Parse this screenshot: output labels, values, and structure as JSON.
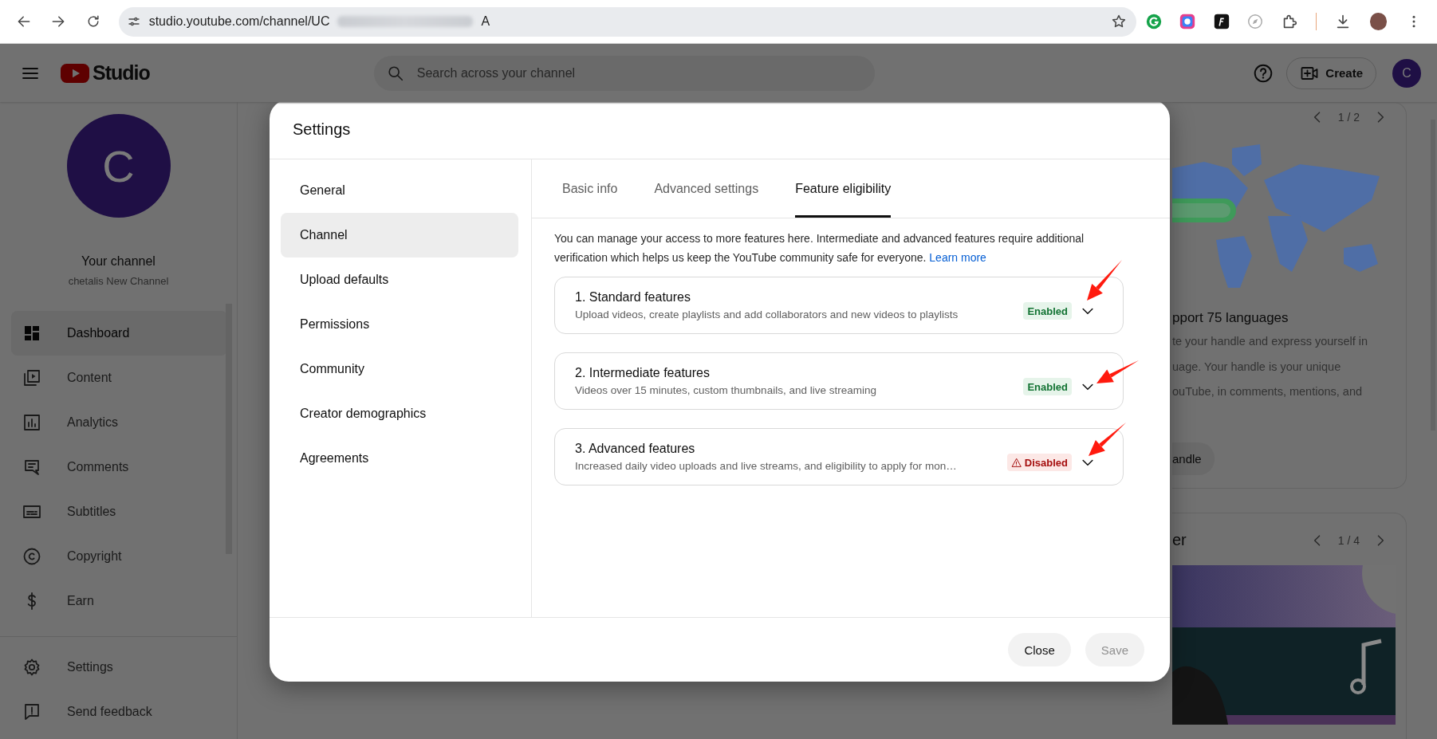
{
  "browser": {
    "url": "studio.youtube.com/channel/UC",
    "url_tail": "A"
  },
  "header": {
    "logo": "Studio",
    "search_placeholder": "Search across your channel",
    "create": "Create",
    "avatar": "C"
  },
  "sidebar": {
    "avatar": "C",
    "title": "Your channel",
    "subtitle": "chetalis New Channel",
    "items": [
      {
        "label": "Dashboard",
        "selected": true
      },
      {
        "label": "Content",
        "selected": false
      },
      {
        "label": "Analytics",
        "selected": false
      },
      {
        "label": "Comments",
        "selected": false
      },
      {
        "label": "Subtitles",
        "selected": false
      },
      {
        "label": "Copyright",
        "selected": false
      },
      {
        "label": "Earn",
        "selected": false
      }
    ],
    "footer_items": [
      {
        "label": "Settings",
        "selected": false
      },
      {
        "label": "Send feedback",
        "selected": false
      }
    ]
  },
  "promo_cards": [
    {
      "pager": "1 / 2",
      "heading": "pport 75 languages",
      "body": [
        "te your handle and express yourself in",
        "uage. Your handle is your unique",
        "ouTube, in comments, mentions, and"
      ],
      "button": "andle"
    },
    {
      "pager": "1 / 4",
      "heading": "er"
    }
  ],
  "dialog": {
    "title": "Settings",
    "nav": [
      {
        "label": "General",
        "selected": false
      },
      {
        "label": "Channel",
        "selected": true
      },
      {
        "label": "Upload defaults",
        "selected": false
      },
      {
        "label": "Permissions",
        "selected": false
      },
      {
        "label": "Community",
        "selected": false
      },
      {
        "label": "Creator demographics",
        "selected": false
      },
      {
        "label": "Agreements",
        "selected": false
      }
    ],
    "tabs": [
      {
        "label": "Basic info",
        "selected": false
      },
      {
        "label": "Advanced settings",
        "selected": false
      },
      {
        "label": "Feature eligibility",
        "selected": true
      }
    ],
    "description": "You can manage your access to more features here. Intermediate and advanced features require additional verification which helps us keep the YouTube community safe for everyone.",
    "learn_more": "Learn more",
    "features": [
      {
        "title": "1. Standard features",
        "description": "Upload videos, create playlists and add collaborators and new videos to playlists",
        "kind": "enabled",
        "badge": "Enabled"
      },
      {
        "title": "2. Intermediate features",
        "description": "Videos over 15 minutes, custom thumbnails, and live streaming",
        "kind": "enabled",
        "badge": "Enabled"
      },
      {
        "title": "3. Advanced features",
        "description": "Increased daily video uploads and live streams, and eligibility to apply for mon…",
        "kind": "disabled",
        "badge": "Disabled"
      }
    ],
    "buttons": [
      {
        "label": "Close",
        "disabled": false
      },
      {
        "label": "Save",
        "disabled": true
      }
    ]
  }
}
